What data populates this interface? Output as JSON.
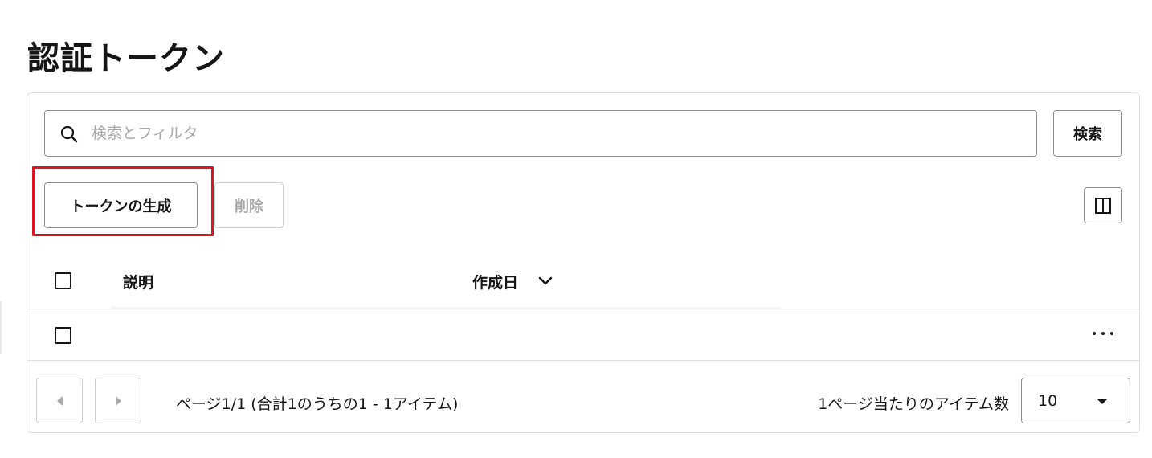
{
  "page": {
    "title": "認証トークン"
  },
  "search": {
    "placeholder": "検索とフィルタ",
    "value": "",
    "icon": "search-icon",
    "button_label": "検索"
  },
  "toolbar": {
    "generate_label": "トークンの生成",
    "delete_label": "削除",
    "columns_icon": "columns-icon",
    "highlight_color": "#e0141e"
  },
  "table": {
    "columns": [
      {
        "label": "説明"
      },
      {
        "label": "作成日",
        "sort_icon": "chevron-down-icon"
      }
    ],
    "rows": [
      {
        "description": "",
        "created": "",
        "actions_icon": "overflow-menu-icon"
      }
    ]
  },
  "pagination": {
    "status": "ページ1/1 (合計1のうちの1 - 1アイテム)",
    "per_page_label": "1ページ当たりのアイテム数",
    "per_page_value": "10",
    "prev_icon": "caret-left-icon",
    "next_icon": "caret-right-icon"
  }
}
